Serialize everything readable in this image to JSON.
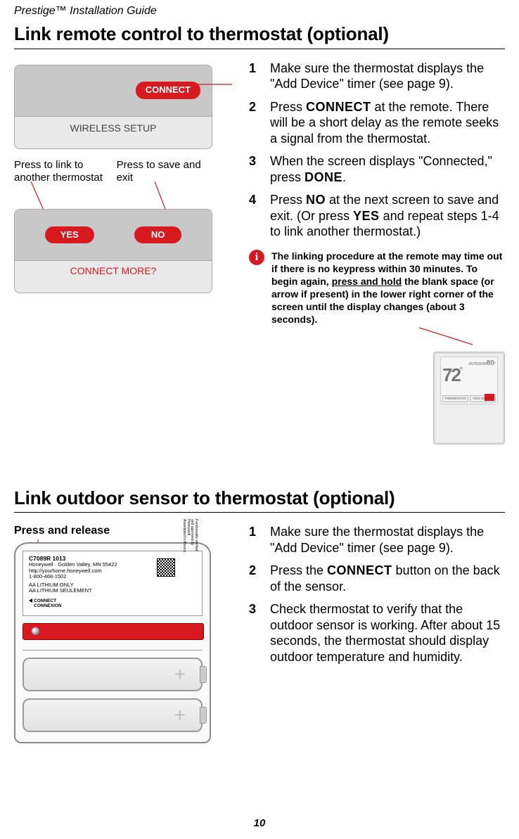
{
  "header": "Prestige™ Installation Guide",
  "page_number": "10",
  "sections": {
    "remote": {
      "heading": "Link remote control to thermostat (optional)",
      "screen1": {
        "button": "CONNECT",
        "label": "WIRELESS SETUP"
      },
      "callouts": {
        "left": "Press to link to another thermostat",
        "right": "Press to save and exit"
      },
      "screen2": {
        "yes": "YES",
        "no": "NO",
        "label": "CONNECT MORE?"
      },
      "steps": {
        "s1": "Make sure the thermostat displays the \"Add Device\" timer (see page 9).",
        "s2a": "Press ",
        "s2b": "CONNECT",
        "s2c": " at the remote. There will be a short delay as the remote seeks a signal from the thermostat.",
        "s3a": "When the screen displays \"Connected,\" press ",
        "s3b": "DONE",
        "s3c": ".",
        "s4a": "Press ",
        "s4b": "NO",
        "s4c": " at the next screen to save and exit. (Or press ",
        "s4d": "YES",
        "s4e": " and repeat steps 1-4 to link another thermostat.)"
      },
      "info": "The linking procedure at the remote may time out if there is no keypress within 30 minutes. To begin again, press and hold the blank space (or arrow if present) in the lower right corner of the screen until the display changes (about 3 seconds).",
      "thumb": {
        "outdoor_label": "OUTDOOR",
        "outdoor": "80",
        "main": "72",
        "left_btn": "THERMOSTAT",
        "right_btn": "THIS DEVICE"
      }
    },
    "sensor": {
      "heading": "Link outdoor sensor to thermostat (optional)",
      "press_release": "Press and release",
      "label": {
        "model": "C7089R 1013",
        "addr": "Honeywell · Golden Valley, MN 55422",
        "url": "http://yourhome.honeywell.com",
        "phone": "1-800-468-1502",
        "batt1": "AA  LITHIUM ONLY",
        "batt2": "AA  LITHIUM SEULEMENT",
        "connect": "CONNECT",
        "connexion": "CONNEXION",
        "side": "Functionality verified and approved by Honeywell. Assembled in Mexico."
      },
      "steps": {
        "s1": "Make sure the thermostat displays the \"Add Device\" timer (see page 9).",
        "s2a": "Press the ",
        "s2b": "CONNECT",
        "s2c": " button on the back of the sensor.",
        "s3": "Check thermostat to verify that the outdoor sensor is working. After about 15 seconds, the thermostat should display outdoor temperature and humidity."
      }
    }
  }
}
